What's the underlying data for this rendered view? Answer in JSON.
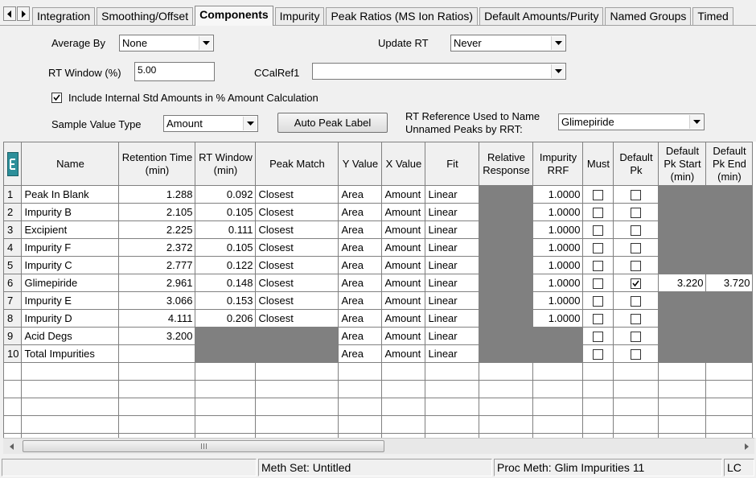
{
  "tabs": [
    {
      "label": "Integration",
      "active": false
    },
    {
      "label": "Smoothing/Offset",
      "active": false
    },
    {
      "label": "Components",
      "active": true
    },
    {
      "label": "Impurity",
      "active": false
    },
    {
      "label": "Peak Ratios (MS Ion Ratios)",
      "active": false
    },
    {
      "label": "Default Amounts/Purity",
      "active": false
    },
    {
      "label": "Named Groups",
      "active": false
    },
    {
      "label": "Timed",
      "active": false
    }
  ],
  "form": {
    "average_by_label": "Average By",
    "average_by_value": "None",
    "update_rt_label": "Update RT",
    "update_rt_value": "Never",
    "rt_window_label": "RT Window (%)",
    "rt_window_value": "5.00",
    "ccalref_label": "CCalRef1",
    "ccalref_value": "",
    "include_internal_label": "Include Internal Std Amounts in % Amount Calculation",
    "include_internal_checked": true,
    "sample_value_type_label": "Sample Value Type",
    "sample_value_type_value": "Amount",
    "auto_peak_label_button": "Auto Peak Label",
    "rt_reference_label_line1": "RT Reference Used to Name",
    "rt_reference_label_line2": "Unnamed Peaks by RRT:",
    "rt_reference_value": "Glimepiride"
  },
  "grid": {
    "columns": [
      "Name",
      "Retention Time (min)",
      "RT Window (min)",
      "Peak Match",
      "Y Value",
      "X Value",
      "Fit",
      "Relative Response",
      "Impurity RRF",
      "Must",
      "Default Pk",
      "Default Pk Start (min)",
      "Default Pk End (min)"
    ],
    "rows": [
      {
        "n": "1",
        "name": "Peak In Blank",
        "rt": "1.288",
        "rtw": "0.092",
        "match": "Closest",
        "y": "Area",
        "x": "Amount",
        "fit": "Linear",
        "rrf": "1.0000",
        "must": false,
        "defpk": false,
        "start": "",
        "end": ""
      },
      {
        "n": "2",
        "name": "Impurity B",
        "rt": "2.105",
        "rtw": "0.105",
        "match": "Closest",
        "y": "Area",
        "x": "Amount",
        "fit": "Linear",
        "rrf": "1.0000",
        "must": false,
        "defpk": false,
        "start": "",
        "end": ""
      },
      {
        "n": "3",
        "name": "Excipient",
        "rt": "2.225",
        "rtw": "0.111",
        "match": "Closest",
        "y": "Area",
        "x": "Amount",
        "fit": "Linear",
        "rrf": "1.0000",
        "must": false,
        "defpk": false,
        "start": "",
        "end": ""
      },
      {
        "n": "4",
        "name": "Impurity F",
        "rt": "2.372",
        "rtw": "0.105",
        "match": "Closest",
        "y": "Area",
        "x": "Amount",
        "fit": "Linear",
        "rrf": "1.0000",
        "must": false,
        "defpk": false,
        "start": "",
        "end": ""
      },
      {
        "n": "5",
        "name": "Impurity C",
        "rt": "2.777",
        "rtw": "0.122",
        "match": "Closest",
        "y": "Area",
        "x": "Amount",
        "fit": "Linear",
        "rrf": "1.0000",
        "must": false,
        "defpk": false,
        "start": "",
        "end": ""
      },
      {
        "n": "6",
        "name": "Glimepiride",
        "rt": "2.961",
        "rtw": "0.148",
        "match": "Closest",
        "y": "Area",
        "x": "Amount",
        "fit": "Linear",
        "rrf": "1.0000",
        "must": false,
        "defpk": true,
        "start": "3.220",
        "end": "3.720"
      },
      {
        "n": "7",
        "name": "Impurity E",
        "rt": "3.066",
        "rtw": "0.153",
        "match": "Closest",
        "y": "Area",
        "x": "Amount",
        "fit": "Linear",
        "rrf": "1.0000",
        "must": false,
        "defpk": false,
        "start": "",
        "end": ""
      },
      {
        "n": "8",
        "name": "Impurity D",
        "rt": "4.111",
        "rtw": "0.206",
        "match": "Closest",
        "y": "Area",
        "x": "Amount",
        "fit": "Linear",
        "rrf": "1.0000",
        "must": false,
        "defpk": false,
        "start": "",
        "end": ""
      },
      {
        "n": "9",
        "name": "Acid Degs",
        "rt": "3.200",
        "rtw": "",
        "match": "",
        "y": "Area",
        "x": "Amount",
        "fit": "Linear",
        "rrf": "",
        "must": false,
        "defpk": false,
        "start": "",
        "end": ""
      },
      {
        "n": "10",
        "name": "Total Impurities",
        "rt": "",
        "rtw": "",
        "match": "",
        "y": "Area",
        "x": "Amount",
        "fit": "Linear",
        "rrf": "",
        "must": false,
        "defpk": false,
        "start": "",
        "end": ""
      }
    ],
    "empty_rows": 5
  },
  "status": {
    "meth_set": "Meth Set: Untitled",
    "proc_meth": "Proc Meth: Glim Impurities 11",
    "mode": "LC"
  },
  "colors": {
    "disabled_cell": "#808080",
    "header_bg": "#f0f0f0",
    "window_bg": "#f0f0f0",
    "corner_icon": "#2d8f9a"
  }
}
